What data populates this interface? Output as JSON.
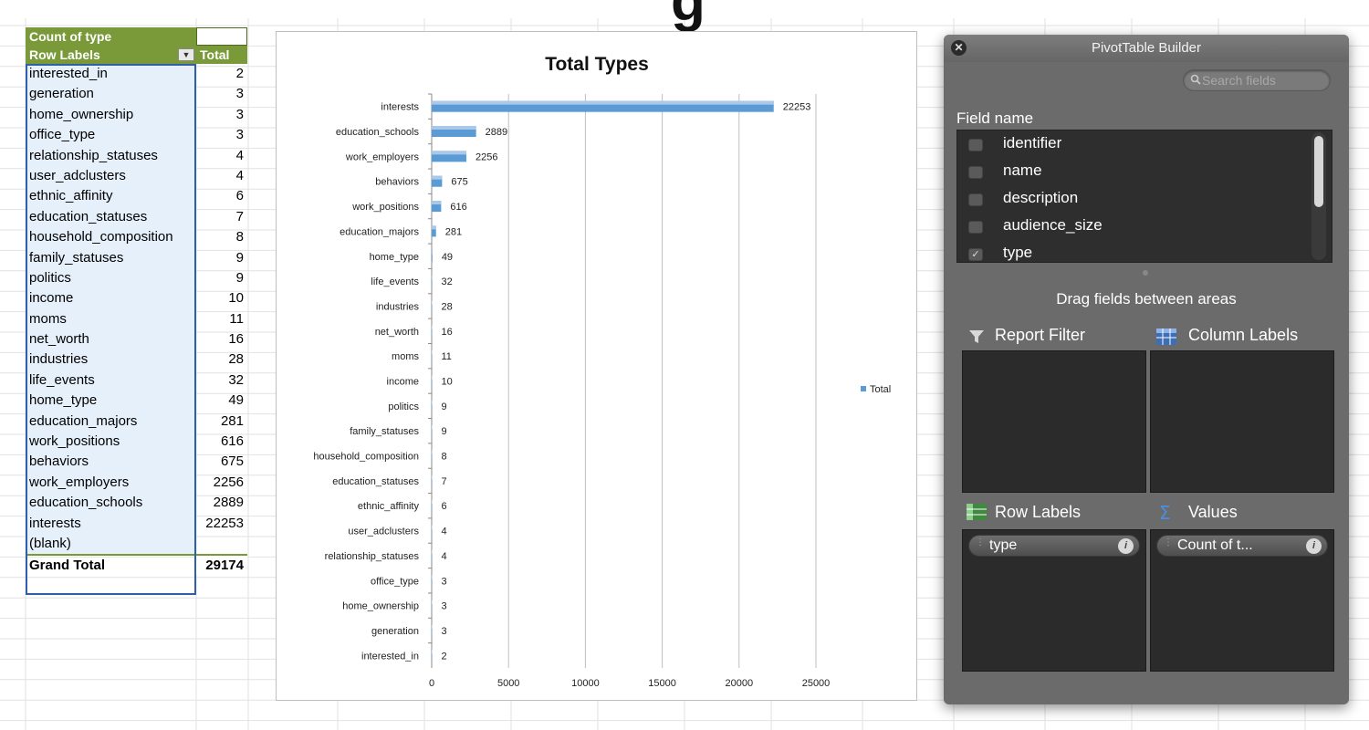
{
  "top_fragment": "g",
  "pivot": {
    "header_count": "Count of type",
    "row_labels_header": "Row Labels",
    "total_header": "Total",
    "rows": [
      {
        "label": "interested_in",
        "value": "2"
      },
      {
        "label": "generation",
        "value": "3"
      },
      {
        "label": "home_ownership",
        "value": "3"
      },
      {
        "label": "office_type",
        "value": "3"
      },
      {
        "label": "relationship_statuses",
        "value": "4"
      },
      {
        "label": "user_adclusters",
        "value": "4"
      },
      {
        "label": "ethnic_affinity",
        "value": "6"
      },
      {
        "label": "education_statuses",
        "value": "7"
      },
      {
        "label": "household_composition",
        "value": "8"
      },
      {
        "label": "family_statuses",
        "value": "9"
      },
      {
        "label": "politics",
        "value": "9"
      },
      {
        "label": "income",
        "value": "10"
      },
      {
        "label": "moms",
        "value": "11"
      },
      {
        "label": "net_worth",
        "value": "16"
      },
      {
        "label": "industries",
        "value": "28"
      },
      {
        "label": "life_events",
        "value": "32"
      },
      {
        "label": "home_type",
        "value": "49"
      },
      {
        "label": "education_majors",
        "value": "281"
      },
      {
        "label": "work_positions",
        "value": "616"
      },
      {
        "label": "behaviors",
        "value": "675"
      },
      {
        "label": "work_employers",
        "value": "2256"
      },
      {
        "label": "education_schools",
        "value": "2889"
      },
      {
        "label": "interests",
        "value": "22253"
      },
      {
        "label": "(blank)",
        "value": ""
      }
    ],
    "grand_total_label": "Grand Total",
    "grand_total_value": "29174"
  },
  "chart_data": {
    "type": "bar",
    "orientation": "horizontal",
    "title": "Total Types",
    "categories": [
      "interests",
      "education_schools",
      "work_employers",
      "behaviors",
      "work_positions",
      "education_majors",
      "home_type",
      "life_events",
      "industries",
      "net_worth",
      "moms",
      "income",
      "politics",
      "family_statuses",
      "household_composition",
      "education_statuses",
      "ethnic_affinity",
      "user_adclusters",
      "relationship_statuses",
      "office_type",
      "home_ownership",
      "generation",
      "interested_in"
    ],
    "series": [
      {
        "name": "Total",
        "values": [
          22253,
          2889,
          2256,
          675,
          616,
          281,
          49,
          32,
          28,
          16,
          11,
          10,
          9,
          9,
          8,
          7,
          6,
          4,
          4,
          3,
          3,
          3,
          2
        ]
      }
    ],
    "xlim": [
      0,
      25000
    ],
    "xticks": [
      0,
      5000,
      10000,
      15000,
      20000,
      25000
    ],
    "grid": true,
    "legend": "right",
    "bar_color": "#5b9bd5"
  },
  "builder": {
    "title": "PivotTable Builder",
    "search_placeholder": "Search fields",
    "field_name_label": "Field name",
    "fields": [
      {
        "label": "identifier",
        "checked": false
      },
      {
        "label": "name",
        "checked": false
      },
      {
        "label": "description",
        "checked": false
      },
      {
        "label": "audience_size",
        "checked": false
      },
      {
        "label": "type",
        "checked": true
      }
    ],
    "drag_label": "Drag fields between areas",
    "report_filter_label": "Report Filter",
    "column_labels_label": "Column Labels",
    "row_labels_label": "Row Labels",
    "values_label": "Values",
    "row_pill": "type",
    "values_pill": "Count of t..."
  }
}
